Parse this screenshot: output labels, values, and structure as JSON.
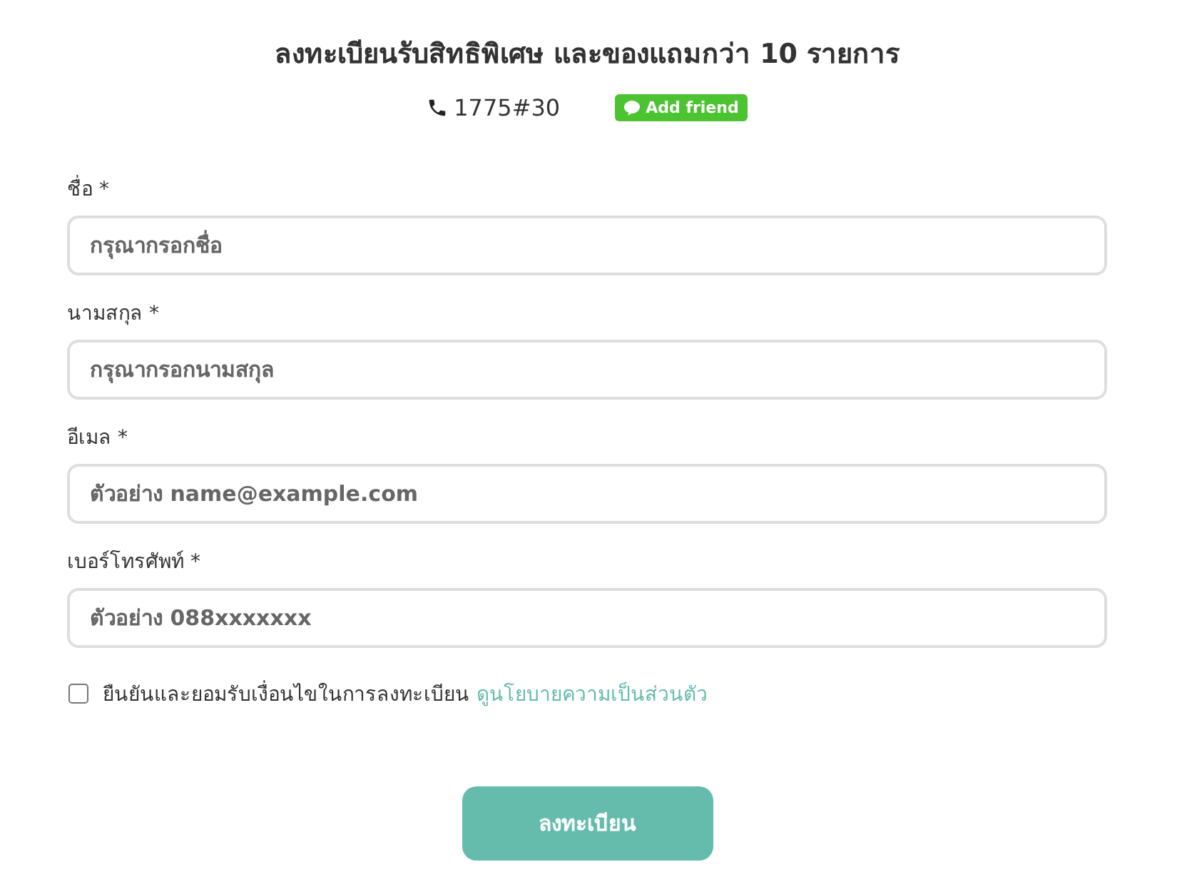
{
  "header": {
    "title": "ลงทะเบียนรับสิทธิพิเศษ และของแถมกว่า 10 รายการ",
    "phone": "1775#30",
    "line_button": "Add friend"
  },
  "fields": [
    {
      "label": "ชื่อ *",
      "placeholder": "กรุณากรอกชื่อ"
    },
    {
      "label": "นามสกุล *",
      "placeholder": "กรุณากรอกนามสกุล"
    },
    {
      "label": "อีเมล *",
      "placeholder": "ตัวอย่าง name@example.com"
    },
    {
      "label": "เบอร์โทรศัพท์ *",
      "placeholder": "ตัวอย่าง 088xxxxxxx"
    }
  ],
  "consent": {
    "checked": false,
    "text": "ยืนยันและยอมรับเงื่อนไขในการลงทะเบียน",
    "link": "ดูนโยบายความเป็นส่วนตัว"
  },
  "submit": "ลงทะเบียน"
}
